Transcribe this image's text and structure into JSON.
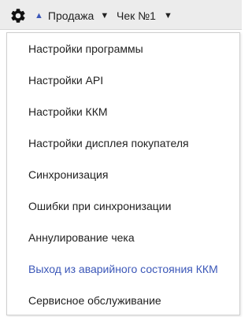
{
  "toolbar": {
    "gear_icon": "gear-icon",
    "mode_label": "Продажа",
    "mode_arrow": "▲",
    "mode_dropdown": "▼",
    "check_label": "Чек №1",
    "check_dropdown": "▼"
  },
  "menu": {
    "items": [
      {
        "label": "Настройки программы"
      },
      {
        "label": "Настройки API"
      },
      {
        "label": "Настройки ККМ"
      },
      {
        "label": "Настройки дисплея покупателя"
      },
      {
        "label": "Синхронизация"
      },
      {
        "label": "Ошибки при синхронизации"
      },
      {
        "label": "Аннулирование чека"
      },
      {
        "label": "Выход из аварийного состояния ККМ"
      },
      {
        "label": "Сервисное обслуживание"
      }
    ]
  },
  "colors": {
    "accent": "#3b57b8",
    "text": "#222222",
    "toolbar_bg": "#ececec"
  }
}
